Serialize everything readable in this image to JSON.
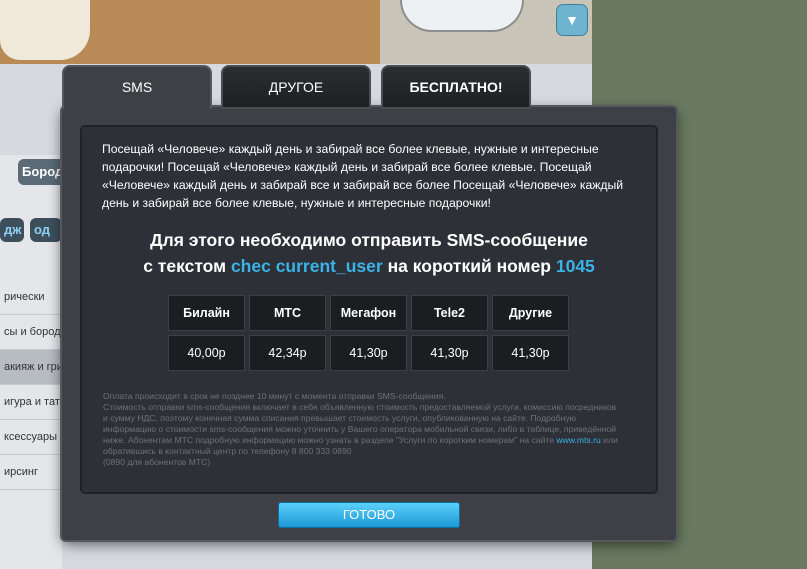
{
  "background": {
    "side_buttons": [
      "Бород",
      "дж",
      "од"
    ],
    "list_items": [
      "рически",
      "сы и бороды",
      "акияж и гри",
      "игура и тату",
      "ксессуары л",
      "ирсинг"
    ]
  },
  "tabs": [
    {
      "label": "SMS",
      "active": true
    },
    {
      "label": "ДРУГОЕ",
      "active": false
    },
    {
      "label": "БЕСПЛАТНО!",
      "active": false
    }
  ],
  "description": "Посещай «Человече» каждый день и забирай все более клевые, нужные и интересные подарочки! Посещай «Человече» каждый день и забирай все более клевые. Посещай «Человече» каждый день и забирай все и забирай все более Посещай «Человече» каждый день и забирай все более клевые, нужные и интересные подарочки!",
  "headline": {
    "line1": "Для этого необходимо отправить SMS-сообщение",
    "prefix": "с текстом ",
    "code": "chec current_user",
    "middle": " на короткий номер ",
    "number": "1045"
  },
  "operators": [
    {
      "name": "Билайн",
      "price": "40,00р"
    },
    {
      "name": "МТС",
      "price": "42,34р"
    },
    {
      "name": "Мегафон",
      "price": "41,30р"
    },
    {
      "name": "Tele2",
      "price": "41,30р"
    },
    {
      "name": "Другие",
      "price": "41,30р"
    }
  ],
  "fine_print": {
    "line1": "Оплата происходит в срок не позднее 10 минут с момента отправки SMS-сообщения.",
    "line2": "Стоимость отправки sms-сообщения включает в себя объявленную стоимость предоставляемой услуги, комиссию посредников и сумму НДС, поэтому конечная сумма списания превышает стоимость услуги, опубликованную на сайте. Подробную информацию о стоимости sms-сообщения можно уточнить у Вашего оператора мобильной связи, либо в таблице, приведённой ниже. Абонентам МТС подробную информацию можно узнать в разделе \"Услуги по коротким номерам\" на сайте ",
    "link": "www.mts.ru",
    "line3": " или обратившись в контактный центр по телефону 8 800 333 0890",
    "line4": "(0890 для абонентов МТС)"
  },
  "done_label": "ГОТОВО"
}
